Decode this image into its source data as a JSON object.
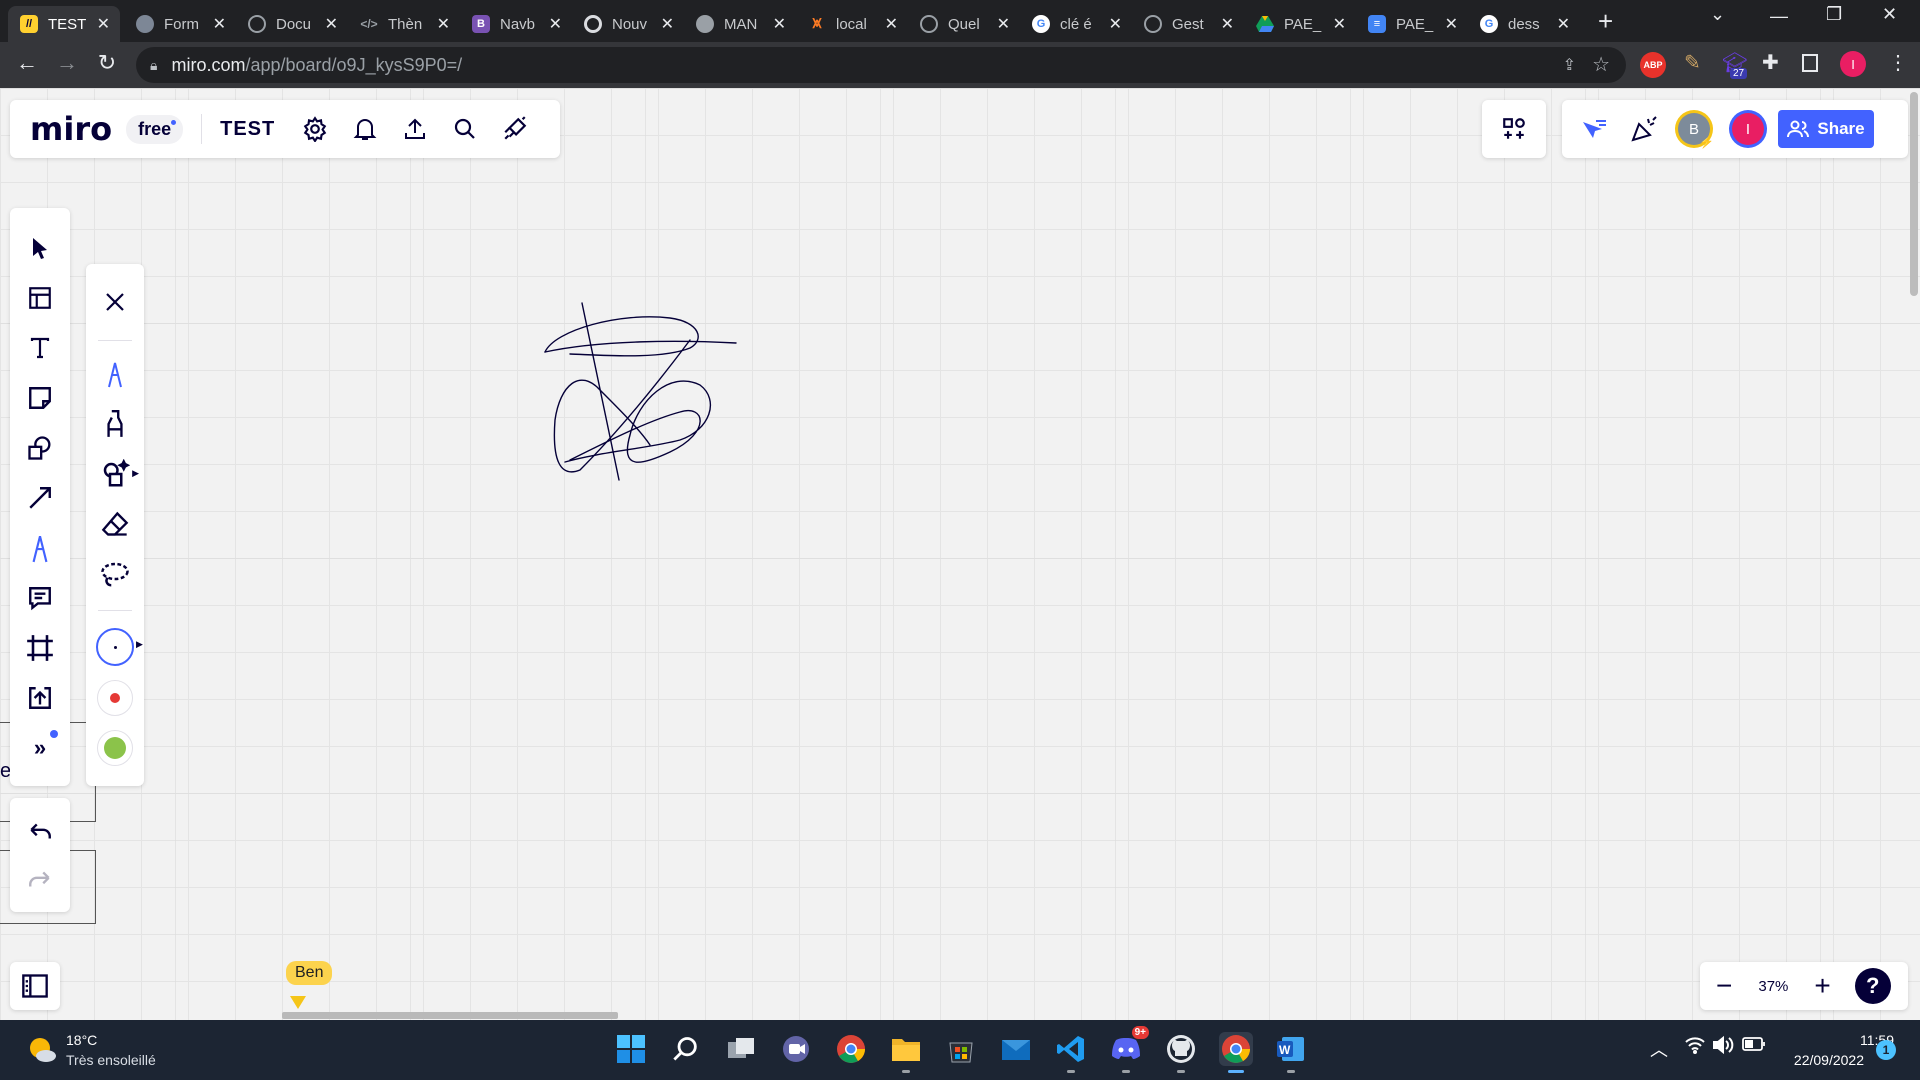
{
  "browser": {
    "tabs": [
      {
        "title": "TEST",
        "icon": "miro-icon",
        "color": "#ffd02f",
        "active": true
      },
      {
        "title": "Form",
        "icon": "chat-icon",
        "color": "#7d8796"
      },
      {
        "title": "Docu",
        "icon": "globe-icon",
        "color": "#9aa0a6"
      },
      {
        "title": "Thèn",
        "icon": "code-icon",
        "color": "#9aa0a6"
      },
      {
        "title": "Navb",
        "icon": "bootstrap-icon",
        "color": "#7952b3",
        "glyph": "B"
      },
      {
        "title": "Nouv",
        "icon": "chrome-icon",
        "color": "#9aa0a6"
      },
      {
        "title": "MAN",
        "icon": "octocat-icon",
        "color": "#9aa0a6"
      },
      {
        "title": "local",
        "icon": "xampp-icon",
        "color": "#fb7a24"
      },
      {
        "title": "Quel",
        "icon": "globe-icon",
        "color": "#9aa0a6"
      },
      {
        "title": "clé é",
        "icon": "google-icon",
        "color": "#ffffff"
      },
      {
        "title": "Gest",
        "icon": "globe-icon",
        "color": "#9aa0a6"
      },
      {
        "title": "PAE_",
        "icon": "drive-icon",
        "color": "#0f9d58"
      },
      {
        "title": "PAE_",
        "icon": "docs-icon",
        "color": "#4285f4"
      },
      {
        "title": "dess",
        "icon": "google-icon",
        "color": "#ffffff"
      }
    ],
    "url_host": "miro.com",
    "url_path": "/app/board/o9J_kysS9P0=/",
    "extensions": {
      "abp": "ABP",
      "badge_count": "27",
      "profile_initial": "I"
    }
  },
  "miro": {
    "logo": "miro",
    "plan_badge": "free",
    "board_name": "TEST",
    "share_label": "Share",
    "avatars": [
      {
        "initial": "B",
        "color": "#7d8b9a",
        "ring": "#f5c518"
      },
      {
        "initial": "I",
        "color": "#e91e63",
        "ring": "#4262ff"
      }
    ],
    "zoom_level": "37%",
    "cursor_user": "Ben",
    "left_toolbar": [
      "select-tool",
      "templates-tool",
      "text-tool",
      "sticky-note-tool",
      "shapes-tool",
      "connection-line-tool",
      "pen-tool",
      "comment-tool",
      "frame-tool",
      "upload-tool",
      "more-tools"
    ],
    "pen_submenu": [
      "close",
      "pen",
      "highlighter",
      "smart-drawing",
      "eraser",
      "lasso"
    ],
    "pen_colors": {
      "stroke": "#050038",
      "red": "#e53935",
      "green": "#8bc34a",
      "accent": "#4262ff"
    },
    "partial_text": "e"
  },
  "taskbar": {
    "weather_temp": "18°C",
    "weather_desc": "Très ensoleillé",
    "time": "11:59",
    "date": "22/09/2022",
    "notification_count": "1",
    "discord_badge": "9+",
    "apps": [
      "windows-start-icon",
      "search-icon",
      "task-view-icon",
      "teams-icon",
      "chrome-icon",
      "file-explorer-icon",
      "store-icon",
      "mail-icon",
      "vscode-icon",
      "discord-icon",
      "github-icon",
      "chrome-active-icon",
      "word-icon"
    ]
  }
}
